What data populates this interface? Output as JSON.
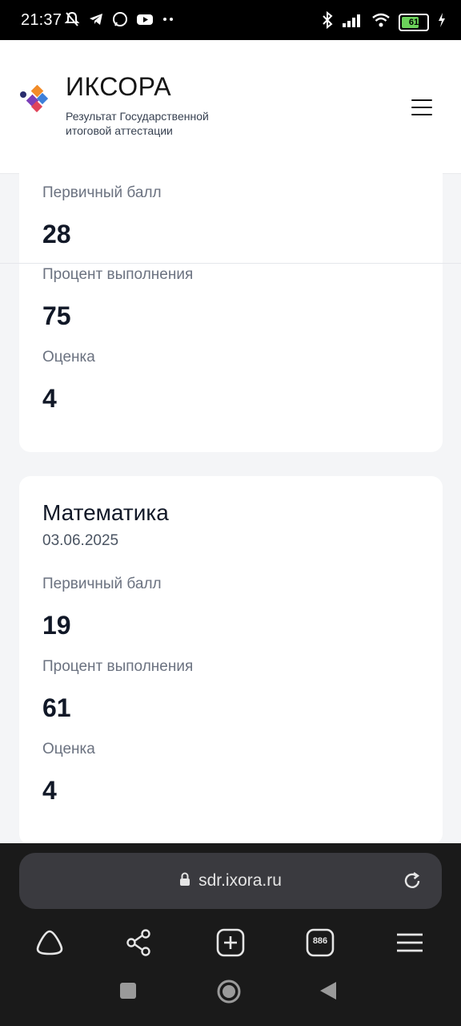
{
  "status_bar": {
    "time": "21:37",
    "battery": "61"
  },
  "header": {
    "brand": "ИКСОРА",
    "subtitle_line1": "Результат Государственной",
    "subtitle_line2": "итоговой аттестации"
  },
  "results": [
    {
      "primary_score_label": "Первичный балл",
      "primary_score": "28",
      "percent_label": "Процент выполнения",
      "percent": "75",
      "grade_label": "Оценка",
      "grade": "4"
    },
    {
      "subject": "Математика",
      "date": "03.06.2025",
      "primary_score_label": "Первичный балл",
      "primary_score": "19",
      "percent_label": "Процент выполнения",
      "percent": "61",
      "grade_label": "Оценка",
      "grade": "4"
    }
  ],
  "browser": {
    "url": "sdr.ixora.ru",
    "tabs_count": "886"
  },
  "colors": {
    "logo_orange": "#f28c28",
    "logo_blue": "#3d7fd9",
    "logo_purple": "#7b3fb8",
    "logo_red": "#e0445a",
    "logo_navy": "#2b2d6e"
  }
}
